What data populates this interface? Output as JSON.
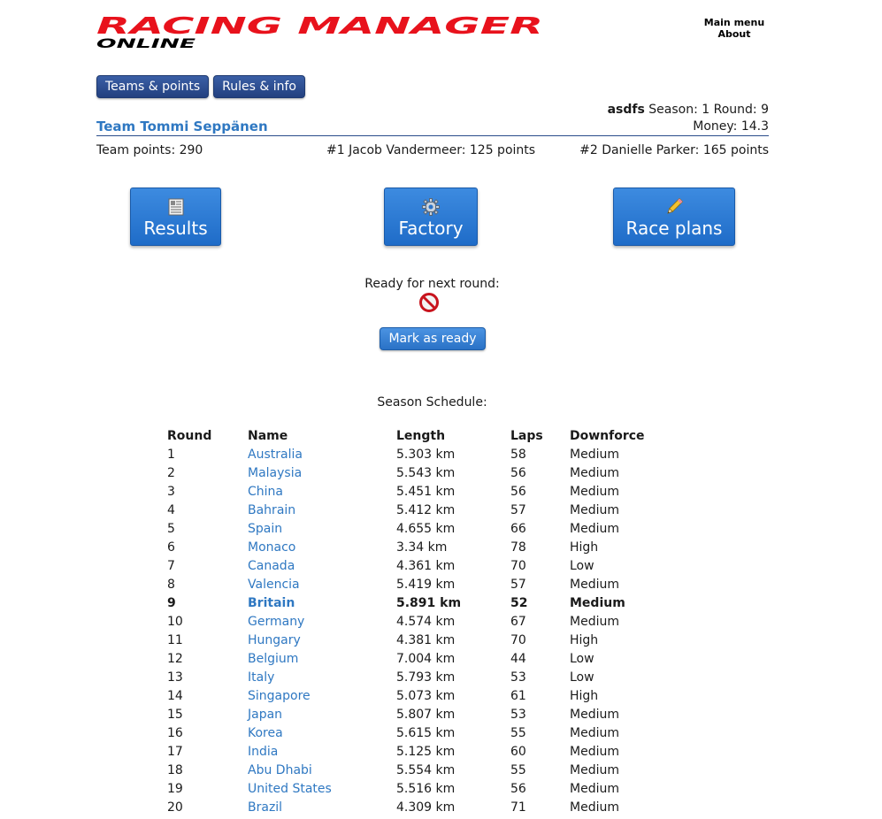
{
  "header": {
    "logo_line1": "RACING MANAGER",
    "logo_line2": "ONLINE",
    "logo_color": "#e8121c",
    "main_menu": "Main menu",
    "about": "About"
  },
  "tabs": [
    {
      "label": "Teams & points"
    },
    {
      "label": "Rules & info"
    }
  ],
  "status": {
    "user": "asdfs",
    "season_text": "Season: 1 Round: 9",
    "money_text": "Money: 14.3"
  },
  "team": {
    "name": "Team Tommi Seppänen",
    "points_text": "Team points: 290",
    "driver1_text": "#1 Jacob Vandermeer: 125 points",
    "driver2_text": "#2 Danielle Parker: 165 points"
  },
  "actions": {
    "results": {
      "label": "Results",
      "icon": "newspaper-icon"
    },
    "factory": {
      "label": "Factory",
      "icon": "gear-icon"
    },
    "race_plans": {
      "label": "Race plans",
      "icon": "pencil-icon"
    }
  },
  "ready": {
    "label": "Ready for next round:",
    "status_icon": "not-ready-icon",
    "button": "Mark as ready"
  },
  "schedule": {
    "title": "Season Schedule:",
    "headers": {
      "round": "Round",
      "name": "Name",
      "length": "Length",
      "laps": "Laps",
      "downforce": "Downforce"
    },
    "current_round": 9,
    "rows": [
      {
        "round": "1",
        "name": "Australia",
        "length": "5.303 km",
        "laps": "58",
        "downforce": "Medium"
      },
      {
        "round": "2",
        "name": "Malaysia",
        "length": "5.543 km",
        "laps": "56",
        "downforce": "Medium"
      },
      {
        "round": "3",
        "name": "China",
        "length": "5.451 km",
        "laps": "56",
        "downforce": "Medium"
      },
      {
        "round": "4",
        "name": "Bahrain",
        "length": "5.412 km",
        "laps": "57",
        "downforce": "Medium"
      },
      {
        "round": "5",
        "name": "Spain",
        "length": "4.655 km",
        "laps": "66",
        "downforce": "Medium"
      },
      {
        "round": "6",
        "name": "Monaco",
        "length": "3.34 km",
        "laps": "78",
        "downforce": "High"
      },
      {
        "round": "7",
        "name": "Canada",
        "length": "4.361 km",
        "laps": "70",
        "downforce": "Low"
      },
      {
        "round": "8",
        "name": "Valencia",
        "length": "5.419 km",
        "laps": "57",
        "downforce": "Medium"
      },
      {
        "round": "9",
        "name": "Britain",
        "length": "5.891 km",
        "laps": "52",
        "downforce": "Medium"
      },
      {
        "round": "10",
        "name": "Germany",
        "length": "4.574 km",
        "laps": "67",
        "downforce": "Medium"
      },
      {
        "round": "11",
        "name": "Hungary",
        "length": "4.381 km",
        "laps": "70",
        "downforce": "High"
      },
      {
        "round": "12",
        "name": "Belgium",
        "length": "7.004 km",
        "laps": "44",
        "downforce": "Low"
      },
      {
        "round": "13",
        "name": "Italy",
        "length": "5.793 km",
        "laps": "53",
        "downforce": "Low"
      },
      {
        "round": "14",
        "name": "Singapore",
        "length": "5.073 km",
        "laps": "61",
        "downforce": "High"
      },
      {
        "round": "15",
        "name": "Japan",
        "length": "5.807 km",
        "laps": "53",
        "downforce": "Medium"
      },
      {
        "round": "16",
        "name": "Korea",
        "length": "5.615 km",
        "laps": "55",
        "downforce": "Medium"
      },
      {
        "round": "17",
        "name": "India",
        "length": "5.125 km",
        "laps": "60",
        "downforce": "Medium"
      },
      {
        "round": "18",
        "name": "Abu Dhabi",
        "length": "5.554 km",
        "laps": "55",
        "downforce": "Medium"
      },
      {
        "round": "19",
        "name": "United States",
        "length": "5.516 km",
        "laps": "56",
        "downforce": "Medium"
      },
      {
        "round": "20",
        "name": "Brazil",
        "length": "4.309 km",
        "laps": "71",
        "downforce": "Medium"
      }
    ]
  }
}
